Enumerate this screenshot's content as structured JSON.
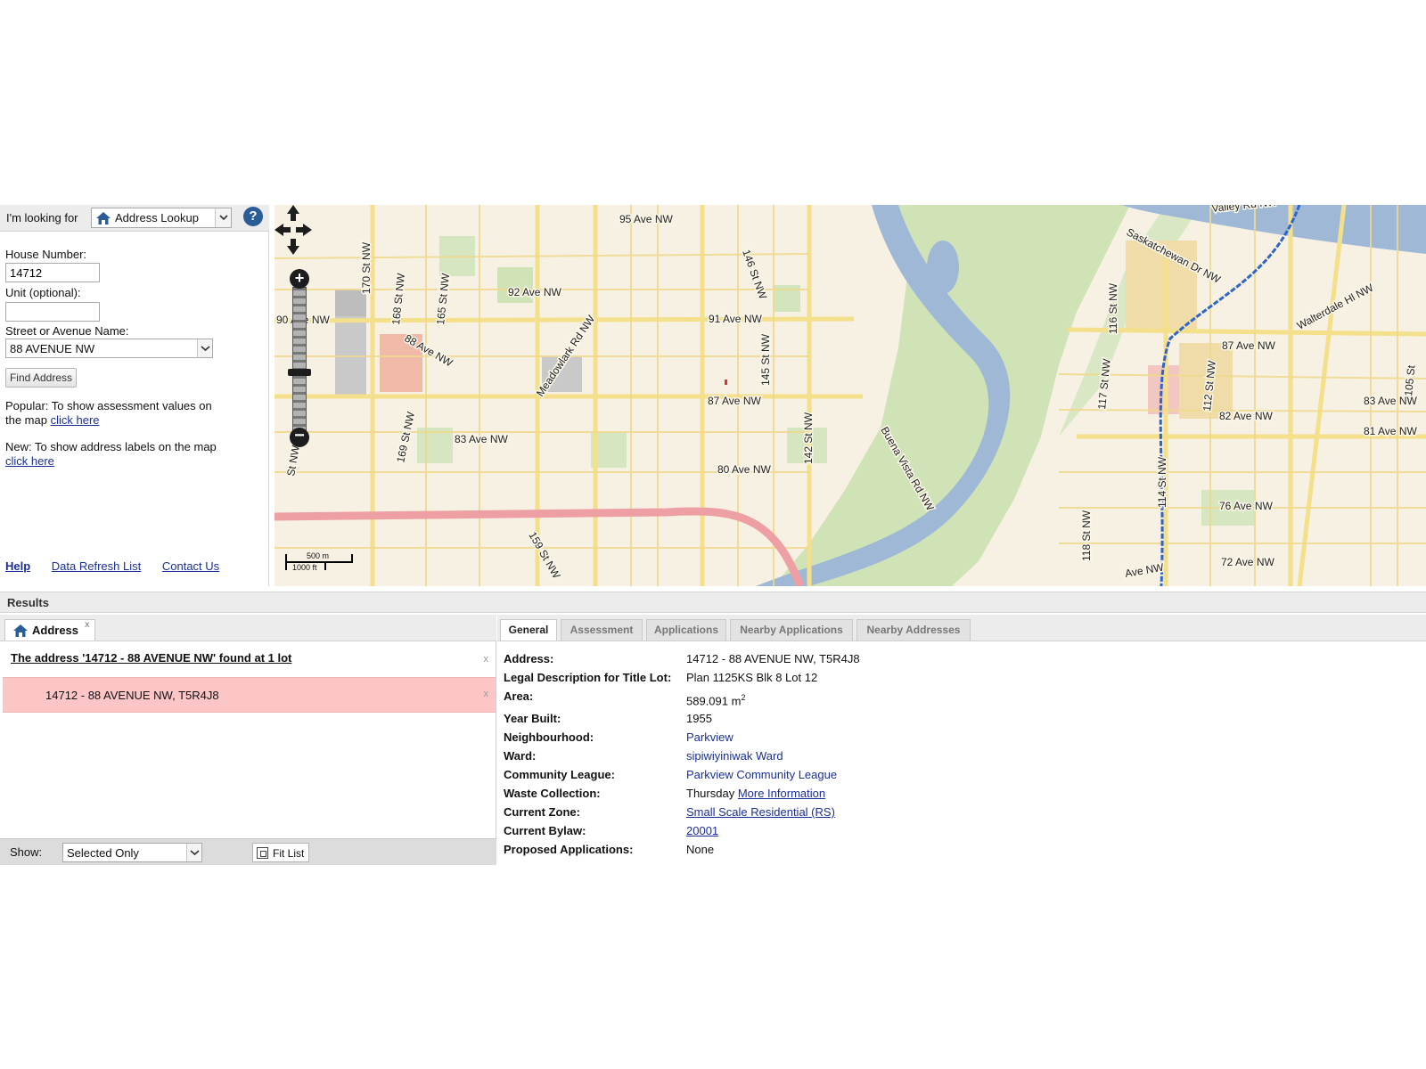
{
  "lookup": {
    "label": "I'm looking for",
    "selected": "Address Lookup",
    "help_glyph": "?"
  },
  "form": {
    "house_number_label": "House Number:",
    "house_number_value": "14712",
    "unit_label": "Unit (optional):",
    "unit_value": "",
    "street_label": "Street or Avenue Name:",
    "street_value": "88 AVENUE NW",
    "find_button": "Find Address"
  },
  "notes": {
    "popular_text": "Popular: To show assessment values on the map ",
    "popular_link": "click here",
    "new_text": "New: To show address labels on the map ",
    "new_link": "click here"
  },
  "footer_links": [
    "Help",
    "Data Refresh List",
    "Contact Us"
  ],
  "map": {
    "street_labels": [
      "95 Ave NW",
      "92 Ave NW",
      "90 Ave NW",
      "88 Ave NW",
      "91 Ave NW",
      "87 Ave NW",
      "83 Ave NW",
      "80 Ave NW",
      "Meadowlark Rd NW",
      "170 St NW",
      "168 St NW",
      "165 St NW",
      "169 St NW",
      "159 St NW",
      "146 St NW",
      "145 St NW",
      "142 St NW",
      "Buena Vista Rd NW",
      "Saskatchewan Dr NW",
      "Walterdale Hl NW",
      "87 Ave NW",
      "83 Ave NW",
      "82 Ave NW",
      "81 Ave NW",
      "76 Ave NW",
      "72 Ave NW",
      "116 St NW",
      "117 St NW",
      "112 St NW",
      "114 St NW",
      "118 St NW",
      "105 St",
      "Valley Rd NW",
      "St NW",
      "Ave NW"
    ],
    "scale_metric": "500 m",
    "scale_imperial": "1000 ft",
    "colors": {
      "land": "#f6f1e2",
      "park": "#cfe3b7",
      "river": "#9fb8d6",
      "road": "#f4df8a",
      "freeway": "#ee9fa4",
      "lrt": "#2f64c9"
    }
  },
  "results": {
    "title": "Results",
    "address_tab": "Address",
    "close_glyph": "x",
    "found_heading": "The address '14712 - 88 AVENUE NW' found at 1 lot",
    "result_row": "14712 - 88 AVENUE NW, T5R4J8",
    "show_label": "Show:",
    "show_value": "Selected Only",
    "fit_list": "Fit List"
  },
  "detail_tabs": [
    "General",
    "Assessment",
    "Applications",
    "Nearby Applications",
    "Nearby Addresses"
  ],
  "details": {
    "address_key": "Address:",
    "address_val": "14712 - 88 AVENUE NW, T5R4J8",
    "legal_key": "Legal Description for Title Lot:",
    "legal_val": "Plan 1125KS Blk 8 Lot 12",
    "area_key": "Area:",
    "area_val": "589.091 m",
    "area_sup": "2",
    "year_key": "Year Built:",
    "year_val": "1955",
    "neighbourhood_key": "Neighbourhood:",
    "neighbourhood_val": "Parkview",
    "ward_key": "Ward:",
    "ward_val": "sipiwiyiniwak Ward",
    "league_key": "Community League:",
    "league_val": "Parkview Community League",
    "waste_key": "Waste Collection:",
    "waste_day": "Thursday",
    "waste_link": "More Information",
    "zone_key": "Current Zone:",
    "zone_val": "Small Scale Residential (RS)",
    "bylaw_key": "Current Bylaw:",
    "bylaw_val": "20001",
    "proposed_key": "Proposed Applications:",
    "proposed_val": "None"
  }
}
